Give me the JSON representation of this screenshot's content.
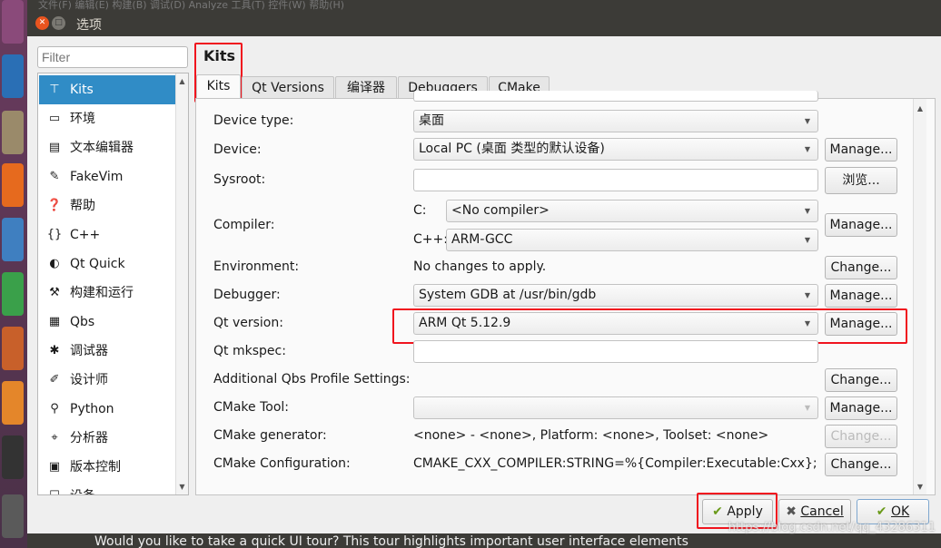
{
  "window": {
    "title": "选项",
    "menubar": "文件(F)  编辑(E)  构建(B)  调试(D)  Analyze  工具(T)  控件(W)  帮助(H)"
  },
  "sidebar": {
    "filter_placeholder": "Filter",
    "items": [
      {
        "label": "Kits",
        "icon": "kits-icon",
        "selected": true
      },
      {
        "label": "环境",
        "icon": "monitor-icon"
      },
      {
        "label": "文本编辑器",
        "icon": "text-editor-icon"
      },
      {
        "label": "FakeVim",
        "icon": "fakevim-icon"
      },
      {
        "label": "帮助",
        "icon": "help-icon"
      },
      {
        "label": "C++",
        "icon": "braces-icon"
      },
      {
        "label": "Qt Quick",
        "icon": "qt-quick-icon"
      },
      {
        "label": "构建和运行",
        "icon": "hammer-icon"
      },
      {
        "label": "Qbs",
        "icon": "qbs-icon"
      },
      {
        "label": "调试器",
        "icon": "bug-icon"
      },
      {
        "label": "设计师",
        "icon": "pen-icon"
      },
      {
        "label": "Python",
        "icon": "python-icon"
      },
      {
        "label": "分析器",
        "icon": "analyzer-icon"
      },
      {
        "label": "版本控制",
        "icon": "version-control-icon"
      },
      {
        "label": "设备",
        "icon": "device-icon"
      }
    ]
  },
  "main": {
    "header": "Kits",
    "tabs": [
      {
        "label": "Kits",
        "active": true
      },
      {
        "label": "Qt Versions"
      },
      {
        "label": "编译器"
      },
      {
        "label": "Debuggers"
      },
      {
        "label": "CMake"
      }
    ],
    "fields": {
      "device_type": {
        "label": "Device type:",
        "value": "桌面"
      },
      "device": {
        "label": "Device:",
        "value": "Local PC (桌面 类型的默认设备)",
        "button": "Manage..."
      },
      "sysroot": {
        "label": "Sysroot:",
        "value": "",
        "button": "浏览..."
      },
      "compiler": {
        "label": "Compiler:",
        "c_label": "C:",
        "c_value": "<No compiler>",
        "cpp_label": "C++:",
        "cpp_value": "ARM-GCC",
        "button": "Manage..."
      },
      "environment": {
        "label": "Environment:",
        "value": "No changes to apply.",
        "button": "Change..."
      },
      "debugger": {
        "label": "Debugger:",
        "value": "System GDB at /usr/bin/gdb",
        "button": "Manage..."
      },
      "qt_version": {
        "label": "Qt version:",
        "value": "ARM Qt 5.12.9",
        "button": "Manage..."
      },
      "qt_mkspec": {
        "label": "Qt mkspec:",
        "value": ""
      },
      "qbs_profile": {
        "label": "Additional Qbs Profile Settings:",
        "button": "Change..."
      },
      "cmake_tool": {
        "label": "CMake Tool:",
        "value": "",
        "button": "Manage..."
      },
      "cmake_generator": {
        "label": "CMake generator:",
        "value": "<none> - <none>, Platform: <none>, Toolset: <none>",
        "button": "Change..."
      },
      "cmake_config": {
        "label": "CMake Configuration:",
        "value": "CMAKE_CXX_COMPILER:STRING=%{Compiler:Executable:Cxx}; …",
        "button": "Change..."
      }
    }
  },
  "footer": {
    "apply": "Apply",
    "cancel": "Cancel",
    "ok": "OK"
  },
  "bottombar": {
    "text": "Would you like to take a quick UI tour? This tour highlights important user interface elements"
  },
  "watermark": "https://blog.csdn.net/qq_43286311",
  "colors": {
    "selection": "#308cc6",
    "highlight": "#f0141e",
    "titlebar": "#3c3b37"
  }
}
